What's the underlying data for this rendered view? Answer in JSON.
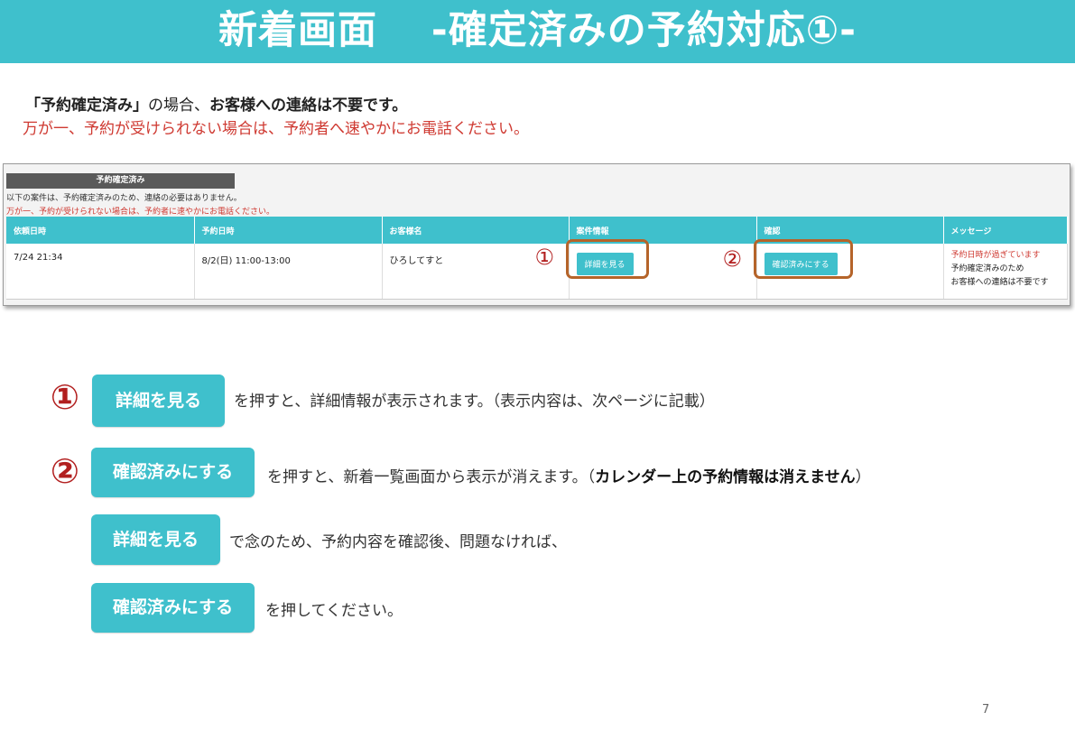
{
  "slide": {
    "title": "新着画面　 -確定済みの予約対応①-",
    "intro_line1_a": "「予約確定済み」",
    "intro_line1_b": "の場合、",
    "intro_line1_c": "お客様への連絡は不要です。",
    "intro_line2": "万が一、予約が受けられない場合は、予約者へ速やかにお電話ください。",
    "page_number": "7"
  },
  "screenshot": {
    "section_tab": "予約確定済み",
    "note1": "以下の案件は、予約確定済みのため、連絡の必要はありません。",
    "note2": "万が一、予約が受けられない場合は、予約者に速やかにお電話ください。",
    "columns": [
      "依頼日時",
      "予約日時",
      "お客様名",
      "案件情報",
      "確認",
      "メッセージ"
    ],
    "row": {
      "request_datetime": "7/24 21:34",
      "reservation_datetime": "8/2(日) 11:00-13:00",
      "customer_name": "ひろしてすと",
      "detail_button": "詳細を見る",
      "confirm_button": "確認済みにする",
      "message_line1": "予約日時が過ぎています",
      "message_line2": "予約確定済みのため",
      "message_line3": "お客様への連絡は不要です"
    },
    "marker1": "①",
    "marker2": "②"
  },
  "instructions": {
    "num1": "①",
    "num2": "②",
    "detail_button": "詳細を見る",
    "confirm_button": "確認済みにする",
    "text1": "を押すと、詳細情報が表示されます。（表示内容は、次ページに記載）",
    "text2_a": "を押すと、新着一覧画面から表示が消えます。（",
    "text2_b": "カレンダー上の予約情報は消えません",
    "text2_c": "）",
    "text3": "で念のため、予約内容を確認後、問題なければ、",
    "text4": "を押してください。"
  },
  "colors": {
    "accent": "#3fc0cc",
    "alert_red": "#cf3a32",
    "number_red": "#b21f1f",
    "highlight_border": "#b5642a"
  }
}
